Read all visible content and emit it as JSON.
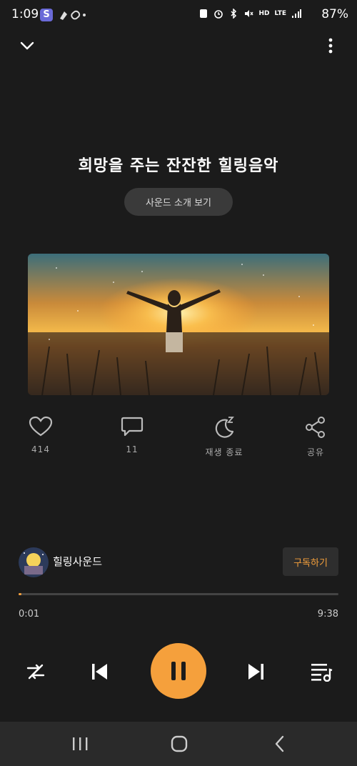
{
  "status_bar": {
    "time": "1:09",
    "app_badge": "S",
    "battery": "87%",
    "icons": [
      "hd-voice-icon",
      "lte-icon",
      "signal-icon",
      "battery-icon",
      "bluetooth-icon",
      "alarm-icon",
      "mute-icon"
    ],
    "network_label": "LTE",
    "hd_label": "HD"
  },
  "track": {
    "title": "희망을 주는 잔잔한 힐링음악",
    "intro_button": "사운드 소개 보기"
  },
  "actions": {
    "like_count": "414",
    "comment_count": "11",
    "sleep_timer_label": "재생 종료",
    "share_label": "공유"
  },
  "channel": {
    "name": "힐링사운드",
    "subscribe_label": "구독하기"
  },
  "progress": {
    "current": "0:01",
    "total": "9:38",
    "fraction": 0.002
  },
  "colors": {
    "accent": "#f5a03c",
    "background": "#1b1b1b"
  }
}
